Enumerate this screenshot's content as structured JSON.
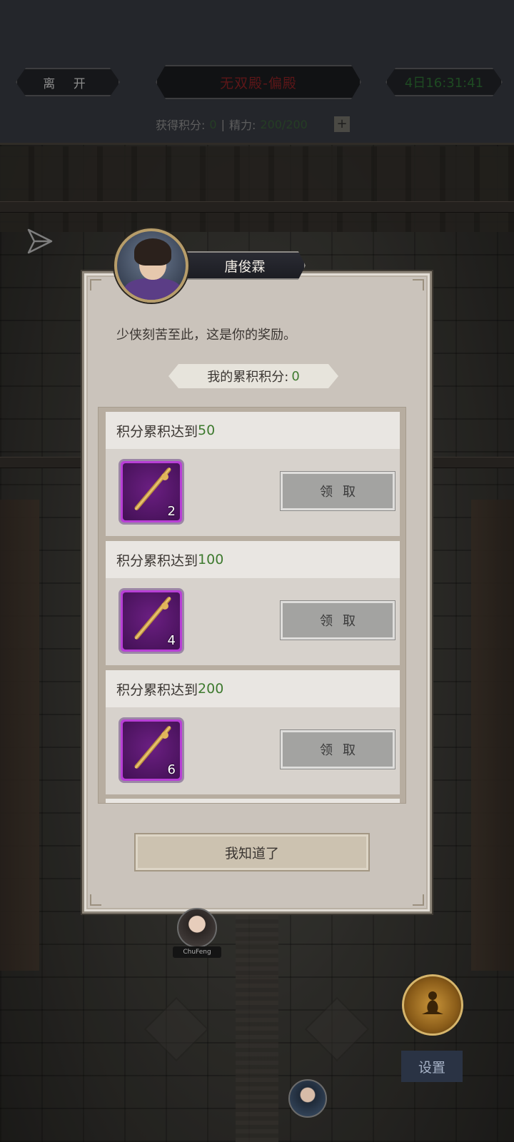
{
  "header": {
    "leave_label": "离 开",
    "location": "无双殿-偏殿",
    "timer": "4日16:31:41",
    "points_label": "获得积分:",
    "points_value": "0",
    "separator": "|",
    "energy_label": "精力:",
    "energy_value": "200/200",
    "plus_label": "+"
  },
  "modal": {
    "npc_name": "唐俊霖",
    "message": "少侠刻苦至此，这是你的奖励。",
    "total_label": "我的累积积分:",
    "total_value": "0",
    "rewards": [
      {
        "condition_label": "积分累积达到",
        "target": "50",
        "item_icon": "needle-icon",
        "item_count": "2",
        "claim_label": "领取"
      },
      {
        "condition_label": "积分累积达到",
        "target": "100",
        "item_icon": "needle-icon",
        "item_count": "4",
        "claim_label": "领取"
      },
      {
        "condition_label": "积分累积达到",
        "target": "200",
        "item_icon": "needle-icon",
        "item_count": "6",
        "claim_label": "领取"
      }
    ],
    "confirm_label": "我知道了"
  },
  "footer": {
    "player_name": "ChuFeng",
    "settings_label": "设置"
  },
  "colors": {
    "accent_green": "#3e7a2f",
    "item_purple": "#b83fd6",
    "panel_bg": "#cac3bb"
  }
}
